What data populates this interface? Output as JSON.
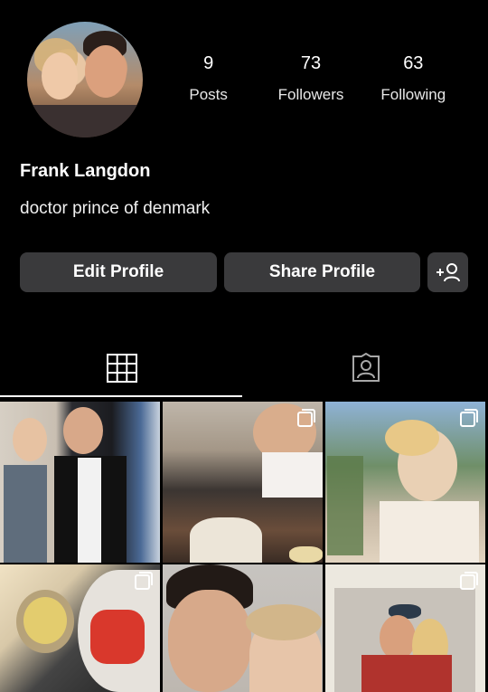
{
  "profile": {
    "name": "Frank Langdon",
    "bio": "doctor prince of denmark"
  },
  "stats": [
    {
      "value": "9",
      "label": "Posts"
    },
    {
      "value": "73",
      "label": "Followers"
    },
    {
      "value": "63",
      "label": "Following"
    }
  ],
  "buttons": {
    "edit": "Edit Profile",
    "share": "Share Profile"
  },
  "icons": {
    "add_person": "add-person-icon",
    "grid_tab": "grid-icon",
    "tagged_tab": "tagged-person-icon",
    "multi_select": "multiple-posts-icon"
  },
  "colors": {
    "background": "#000000",
    "button": "#3a3a3c",
    "text": "#ffffff"
  },
  "posts": [
    {
      "id": "post-1"
    },
    {
      "id": "post-2"
    },
    {
      "id": "post-3"
    },
    {
      "id": "post-4"
    },
    {
      "id": "post-5"
    },
    {
      "id": "post-6"
    }
  ]
}
